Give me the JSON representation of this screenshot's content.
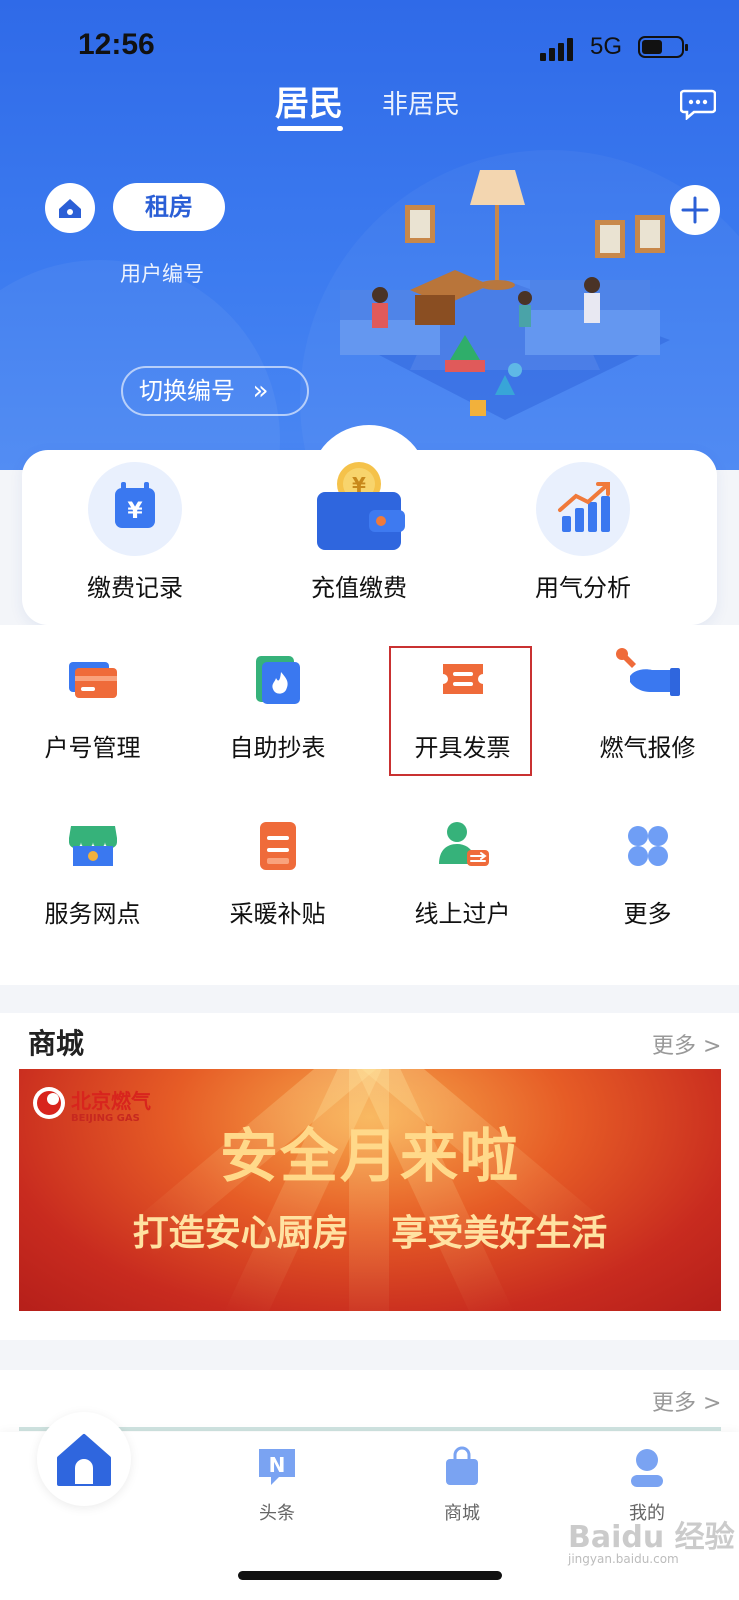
{
  "status_bar": {
    "time": "12:56",
    "network": "5G"
  },
  "header": {
    "tab_resident": "居民",
    "tab_nonresident": "非居民",
    "rent_label": "租房",
    "user_number_label": "用户编号",
    "switch_label": "切换编号"
  },
  "quick_actions": [
    {
      "label": "缴费记录",
      "icon": "bill-calendar-icon"
    },
    {
      "label": "充值缴费",
      "icon": "wallet-icon"
    },
    {
      "label": "用气分析",
      "icon": "bar-chart-icon"
    }
  ],
  "grid": [
    {
      "label": "户号管理",
      "icon": "card-icon"
    },
    {
      "label": "自助抄表",
      "icon": "flame-meter-icon"
    },
    {
      "label": "开具发票",
      "icon": "ticket-icon"
    },
    {
      "label": "燃气报修",
      "icon": "wrench-hand-icon"
    },
    {
      "label": "服务网点",
      "icon": "store-icon"
    },
    {
      "label": "采暖补贴",
      "icon": "subsidy-icon"
    },
    {
      "label": "线上过户",
      "icon": "user-transfer-icon"
    },
    {
      "label": "更多",
      "icon": "four-dots-icon"
    }
  ],
  "mall": {
    "title": "商城",
    "more": "更多 >",
    "banner": {
      "logo_cn": "北京燃气",
      "logo_en": "BEIJING GAS",
      "headline": "安全月来啦",
      "subline": "打造安心厨房 享受美好生活"
    }
  },
  "section2": {
    "more": "更多 >"
  },
  "bottom_nav": [
    {
      "label": "头条",
      "icon": "news-icon"
    },
    {
      "label": "商城",
      "icon": "shopping-bag-icon"
    },
    {
      "label": "我的",
      "icon": "user-icon"
    }
  ],
  "watermark": {
    "main": "Baidu 经验",
    "sub": "jingyan.baidu.com"
  },
  "colors": {
    "primary": "#2f6ae8",
    "highlight": "#c93131",
    "orange": "#ef6b3a"
  }
}
